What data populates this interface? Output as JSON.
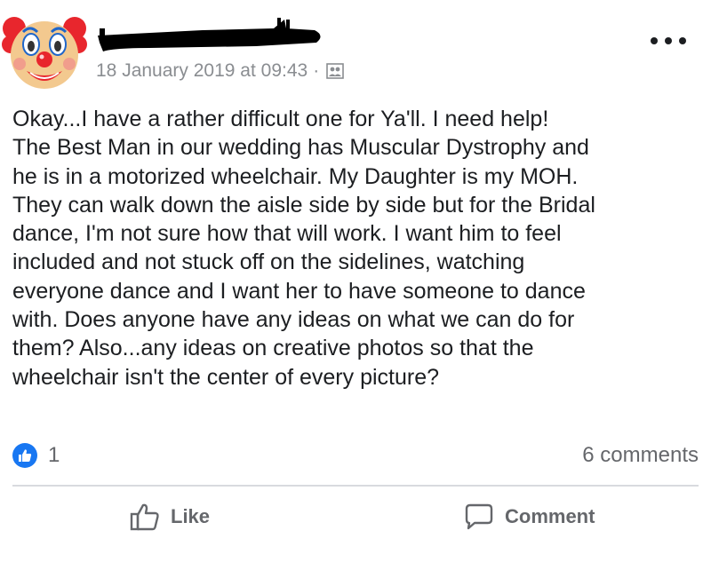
{
  "post": {
    "timestamp": "18 January 2019 at 09:43",
    "separator": "·",
    "audience_icon": "friends-icon",
    "more_icon": "more-horizontal-icon",
    "text_lines": [
      "Okay...I have a rather difficult one for Ya'll. I need help!",
      "The Best Man in our wedding has Muscular Dystrophy and",
      "he is in a motorized wheelchair. My Daughter is my MOH.",
      "They can walk down the aisle side by side but for the Bridal",
      "dance, I'm not sure how that will work. I want him to feel",
      "included and not stuck off on the sidelines, watching",
      "everyone dance and I want her to have someone to dance",
      "with. Does anyone have any ideas on what we can do for",
      "them? Also...any ideas on creative photos so that the",
      "wheelchair isn't the center of every picture?"
    ]
  },
  "reactions": {
    "icon": "like-reaction-icon",
    "count": "1",
    "comments": "6 comments"
  },
  "actions": {
    "like_label": "Like",
    "comment_label": "Comment"
  },
  "colors": {
    "like_blue": "#1877f2",
    "muted_text": "#65676b",
    "timestamp_text": "#8a8d91",
    "divider": "#d8dadf"
  }
}
